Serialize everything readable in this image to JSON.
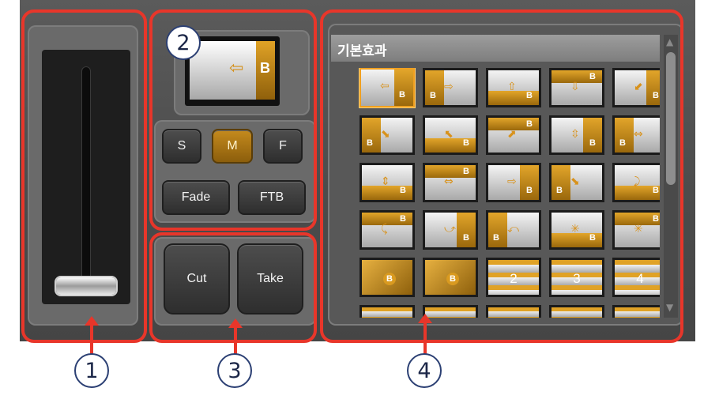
{
  "callouts": [
    "1",
    "2",
    "3",
    "4"
  ],
  "preview": {
    "label": "B"
  },
  "speed_buttons": [
    {
      "label": "S",
      "active": false
    },
    {
      "label": "M",
      "active": true
    },
    {
      "label": "F",
      "active": false
    }
  ],
  "fade_button": "Fade",
  "ftb_button": "FTB",
  "cut_button": "Cut",
  "take_button": "Take",
  "effects_panel": {
    "header": "기본효과",
    "thumb_label": "B",
    "number_thumbs": [
      "2",
      "3",
      "4"
    ]
  },
  "colors": {
    "accent": "#e8362a",
    "gold": "#c48a1d",
    "callout": "#2b3f73"
  }
}
